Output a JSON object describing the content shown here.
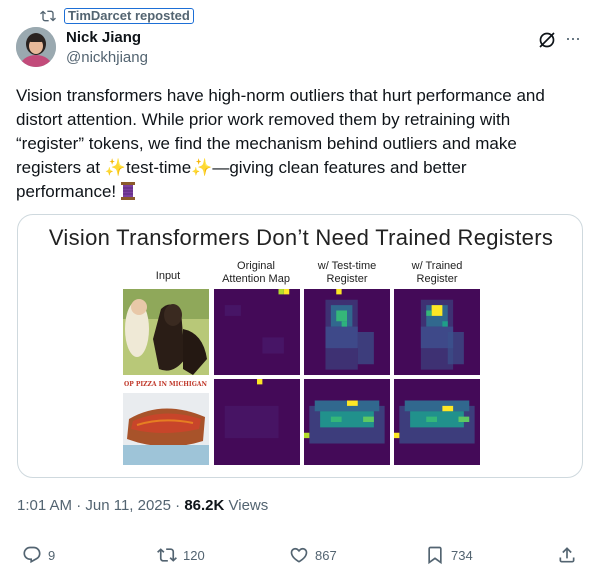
{
  "repost": {
    "label": "TimDarcet reposted",
    "icon": "repost-icon"
  },
  "author": {
    "name": "Nick Jiang",
    "handle": "@nickhjiang",
    "avatar": "avatar"
  },
  "tweet": {
    "line1": "Vision transformers have high-norm outliers that hurt performance and",
    "line2": "distort attention. While prior work removed them by retraining with",
    "line3": "“register” tokens, we find the mechanism behind outliers and make",
    "line4a": "registers at ",
    "line4_spark1": "✨",
    "line4b": "test-time",
    "line4_spark2": "✨",
    "line4c": "—giving clean features and better",
    "line5": "performance! "
  },
  "figure": {
    "title": "Vision Transformers Don’t Need Trained Registers",
    "col_input": "Input",
    "col_original_1": "Original",
    "col_original_2": "Attention Map",
    "col_testtime_1": "w/ Test-time",
    "col_testtime_2": "Register",
    "col_trained_1": "w/ Trained",
    "col_trained_2": "Register",
    "pizza_sign": "OP PIZZA IN MICHIGAN"
  },
  "meta": {
    "time": "1:01 AM · Jun 11, 2025 · ",
    "views_count": "86.2K",
    "views_label": " Views"
  },
  "actions": {
    "replies": "9",
    "reposts": "120",
    "likes": "867",
    "bookmarks": "734"
  },
  "colors": {
    "accent_blue": "#1d9bf0",
    "muted": "#536471",
    "border": "#cfd9de",
    "viridis_dark": "#440a58"
  }
}
